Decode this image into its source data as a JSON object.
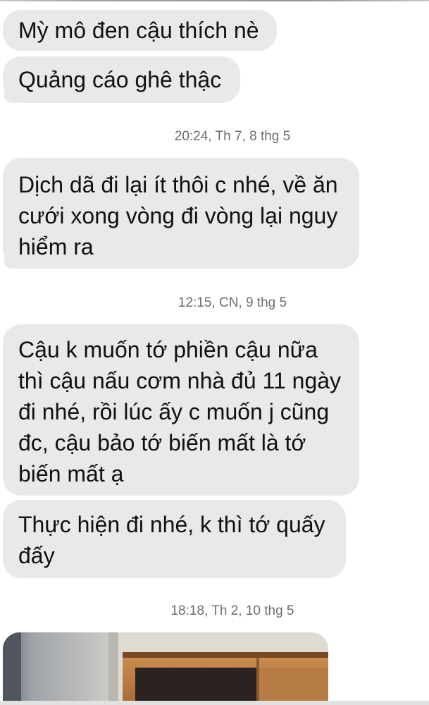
{
  "messages": [
    {
      "lines": [
        "Mỳ mô đen cậu thích nè"
      ]
    },
    {
      "lines": [
        "Quảng cáo ghê thậc"
      ]
    },
    {
      "lines": [
        "Dịch dã đi lại ít thôi c nhé, về ăn",
        "cưới xong vòng đi vòng lại nguy",
        "hiểm ra"
      ]
    },
    {
      "lines": [
        "Cậu k muốn tớ phiền cậu nữa",
        "thì cậu nấu cơm nhà đủ 11 ngày",
        "đi nhé, rồi lúc ấy c muốn j cũng",
        "đc, cậu bảo tớ biến mất là tớ",
        "biến mất ạ"
      ]
    },
    {
      "lines": [
        "Thực hiện đi nhé, k thì tớ quấy",
        "đấy"
      ]
    }
  ],
  "timestamps": [
    "20:24, Th 7, 8 thg 5",
    "12:15, CN, 9 thg 5",
    "18:18, Th 2, 10 thg 5"
  ],
  "colors": {
    "bubble": "#e9e9eb",
    "bubble_text": "#111111",
    "timestamp": "#6d6d72",
    "background": "#ffffff"
  }
}
